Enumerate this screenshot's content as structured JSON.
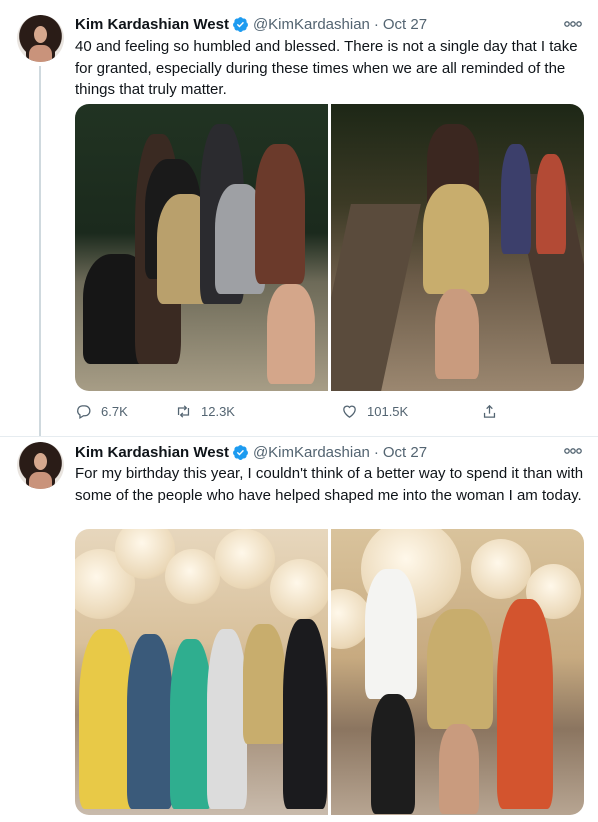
{
  "tweets": [
    {
      "author": {
        "name": "Kim Kardashian West",
        "handle": "@KimKardashian",
        "verified": true
      },
      "date": "Oct 27",
      "text": "40 and feeling so humbled and blessed. There is not a single day that I take for granted, especially during these times when we are all reminded of the things that truly matter.",
      "stats": {
        "replies": "6.7K",
        "retweets": "12.3K",
        "likes": "101.5K"
      }
    },
    {
      "author": {
        "name": "Kim Kardashian West",
        "handle": "@KimKardashian",
        "verified": true
      },
      "date": "Oct 27",
      "text": "For my birthday this year, I couldn't think of a better way to spend it than with some of the people who have helped shaped me into the woman I am today."
    }
  ],
  "separator": "·",
  "icons": {
    "verified": "verified-badge-icon",
    "more": "more-icon",
    "reply": "reply-icon",
    "retweet": "retweet-icon",
    "like": "heart-icon",
    "share": "share-icon"
  },
  "colors": {
    "accent": "#1d9bf0",
    "muted": "#536471",
    "text": "#0f1419",
    "thread": "#cfd9de"
  }
}
